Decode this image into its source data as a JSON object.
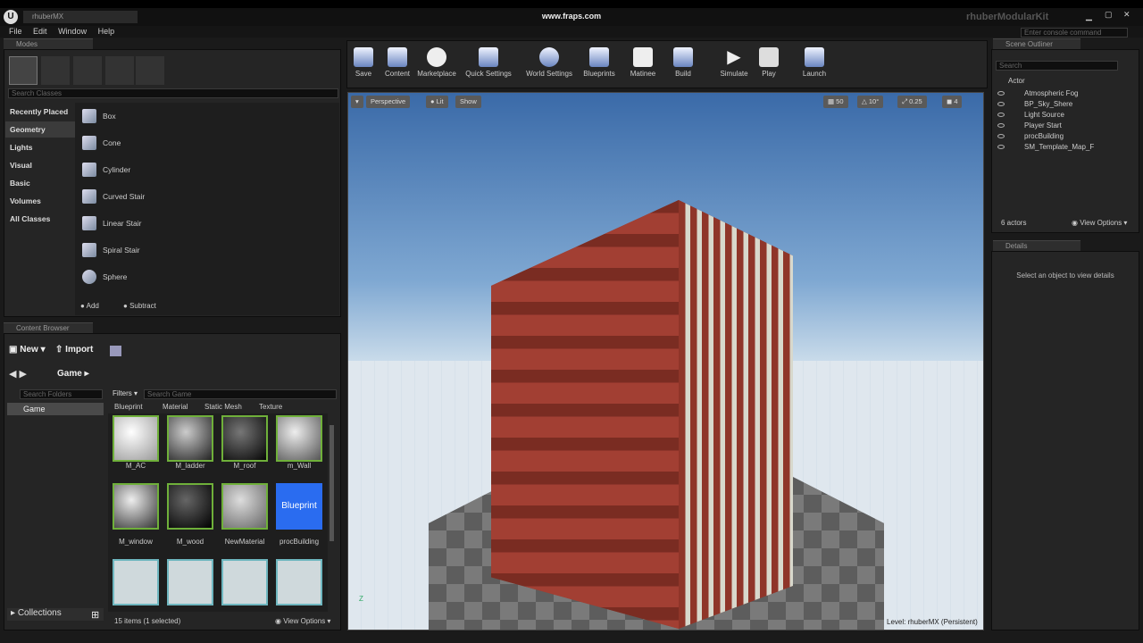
{
  "window": {
    "tab": "rhuberMX",
    "center_title": "www.fraps.com",
    "project": "rhuberModularKit",
    "console_placeholder": "Enter console command"
  },
  "menu": [
    "File",
    "Edit",
    "Window",
    "Help"
  ],
  "modes": {
    "title": "Modes",
    "search_placeholder": "Search Classes",
    "categories": [
      "Recently Placed",
      "Geometry",
      "Lights",
      "Visual",
      "Basic",
      "Volumes",
      "All Classes"
    ],
    "items": [
      "Box",
      "Cone",
      "Cylinder",
      "Curved Stair",
      "Linear Stair",
      "Spiral Stair",
      "Sphere"
    ],
    "add": "Add",
    "subtract": "Subtract"
  },
  "toolbar": [
    "Save",
    "Content",
    "Marketplace",
    "Quick Settings",
    "World Settings",
    "Blueprints",
    "Matinee",
    "Build",
    "Simulate",
    "Play",
    "Launch"
  ],
  "viewport": {
    "perspective": "Perspective",
    "lit": "Lit",
    "show": "Show",
    "grid": "50",
    "angle": "10°",
    "scale": "0.25",
    "cam": "4",
    "level": "Level:  rhuberMX (Persistent)",
    "axis": "Z"
  },
  "content_browser": {
    "title": "Content Browser",
    "new": "New",
    "import": "Import",
    "path": "Game",
    "search_folders": "Search Folders",
    "folder": "Game",
    "filters": "Filters",
    "search_game": "Search Game",
    "filter_tabs": [
      "Blueprint",
      "Material",
      "Static Mesh",
      "Texture"
    ],
    "assets": [
      "M_AC",
      "M_ladder",
      "M_roof",
      "m_Wall",
      "M_window",
      "M_wood",
      "NewMaterial",
      "procBuilding"
    ],
    "blueprint_label": "Blueprint",
    "collections": "Collections",
    "count": "15 items (1 selected)",
    "view_options": "View Options"
  },
  "outliner": {
    "title": "Scene Outliner",
    "search": "Search",
    "column": "Actor",
    "items": [
      "Atmospheric Fog",
      "BP_Sky_Shere",
      "Light Source",
      "Player Start",
      "procBuilding",
      "SM_Template_Map_F"
    ],
    "count": "6 actors",
    "view_options": "View Options"
  },
  "details": {
    "title": "Details",
    "empty": "Select an object to view details"
  }
}
